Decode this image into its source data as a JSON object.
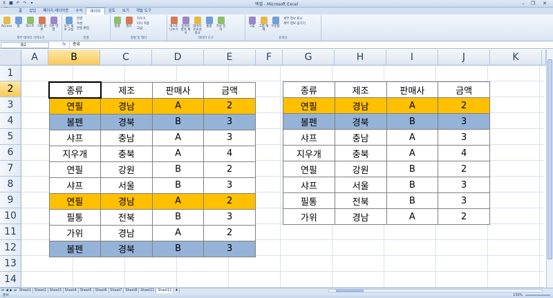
{
  "window": {
    "title": "엑셀 - Microsoft Excel"
  },
  "ribbon": {
    "tabs": [
      "홈",
      "삽입",
      "페이지 레이아웃",
      "수식",
      "데이터",
      "검토",
      "보기",
      "개발 도구"
    ],
    "active_tab": "데이터",
    "groups": [
      {
        "label": "외부 데이터 가져오기",
        "buttons": [
          "Access",
          "웹",
          "텍스트",
          "기타 원본",
          "기존 연결"
        ]
      },
      {
        "label": "연결",
        "buttons": [
          "모두 새로 고침"
        ],
        "small": [
          "연결",
          "속성",
          "연결 편집"
        ]
      },
      {
        "label": "정렬 및 필터",
        "buttons": [
          "정렬",
          "필터"
        ],
        "small": [
          "지우기",
          "다시 적용",
          "고급"
        ]
      },
      {
        "label": "데이터 도구",
        "buttons": [
          "텍스트 나누기",
          "중복된 항목 제거",
          "데이터 유효성 검사",
          "통합",
          "가상 분석"
        ]
      },
      {
        "label": "윤곽선",
        "buttons": [
          "그룹",
          "그룹 해제",
          "부분합"
        ],
        "small": [
          "세부 정보 표시",
          "세부 정보 숨기기"
        ]
      }
    ]
  },
  "formula_bar": {
    "name_box": "B2",
    "fx": "fx",
    "content": "종류"
  },
  "columns": [
    "A",
    "B",
    "C",
    "D",
    "E",
    "F",
    "G",
    "H",
    "I",
    "J",
    "K"
  ],
  "rows": [
    "1",
    "2",
    "3",
    "4",
    "5",
    "6",
    "7",
    "8",
    "9",
    "10",
    "11",
    "12",
    "13",
    "14"
  ],
  "table_left": {
    "headers": [
      "종류",
      "제조",
      "판매사",
      "금액"
    ],
    "rows": [
      {
        "cells": [
          "연필",
          "경남",
          "A",
          "2"
        ],
        "hl": "orange"
      },
      {
        "cells": [
          "볼펜",
          "경북",
          "B",
          "3"
        ],
        "hl": "blue"
      },
      {
        "cells": [
          "샤프",
          "충남",
          "A",
          "3"
        ],
        "hl": ""
      },
      {
        "cells": [
          "지우개",
          "충북",
          "A",
          "4"
        ],
        "hl": ""
      },
      {
        "cells": [
          "연필",
          "강원",
          "B",
          "2"
        ],
        "hl": ""
      },
      {
        "cells": [
          "샤프",
          "서울",
          "B",
          "3"
        ],
        "hl": ""
      },
      {
        "cells": [
          "연필",
          "경남",
          "A",
          "2"
        ],
        "hl": "orange"
      },
      {
        "cells": [
          "필통",
          "전북",
          "B",
          "3"
        ],
        "hl": ""
      },
      {
        "cells": [
          "가위",
          "경남",
          "A",
          "2"
        ],
        "hl": ""
      },
      {
        "cells": [
          "볼펜",
          "경북",
          "B",
          "3"
        ],
        "hl": "blue"
      }
    ]
  },
  "table_right": {
    "headers": [
      "종류",
      "제조",
      "판매사",
      "금액"
    ],
    "rows": [
      {
        "cells": [
          "연필",
          "경남",
          "A",
          "2"
        ],
        "hl": "orange"
      },
      {
        "cells": [
          "볼펜",
          "경북",
          "B",
          "3"
        ],
        "hl": "blue"
      },
      {
        "cells": [
          "샤프",
          "충남",
          "A",
          "3"
        ],
        "hl": ""
      },
      {
        "cells": [
          "지우개",
          "충북",
          "A",
          "4"
        ],
        "hl": ""
      },
      {
        "cells": [
          "연필",
          "강원",
          "B",
          "2"
        ],
        "hl": ""
      },
      {
        "cells": [
          "샤프",
          "서울",
          "B",
          "3"
        ],
        "hl": ""
      },
      {
        "cells": [
          "필통",
          "전북",
          "B",
          "3"
        ],
        "hl": ""
      },
      {
        "cells": [
          "가위",
          "경남",
          "A",
          "2"
        ],
        "hl": ""
      }
    ]
  },
  "sheets": [
    "Sheet1",
    "Sheet2",
    "Sheet3",
    "Sheet4",
    "Sheet5",
    "Sheet6",
    "Sheet7",
    "Sheet8",
    "Sheet11",
    "Sheet12"
  ],
  "active_sheet": "Sheet12",
  "status": {
    "ready": "준비",
    "zoom": "150%"
  },
  "colors": {
    "orange": "#ffc000",
    "blue": "#95b3d7",
    "selection": "#f8c95c"
  }
}
